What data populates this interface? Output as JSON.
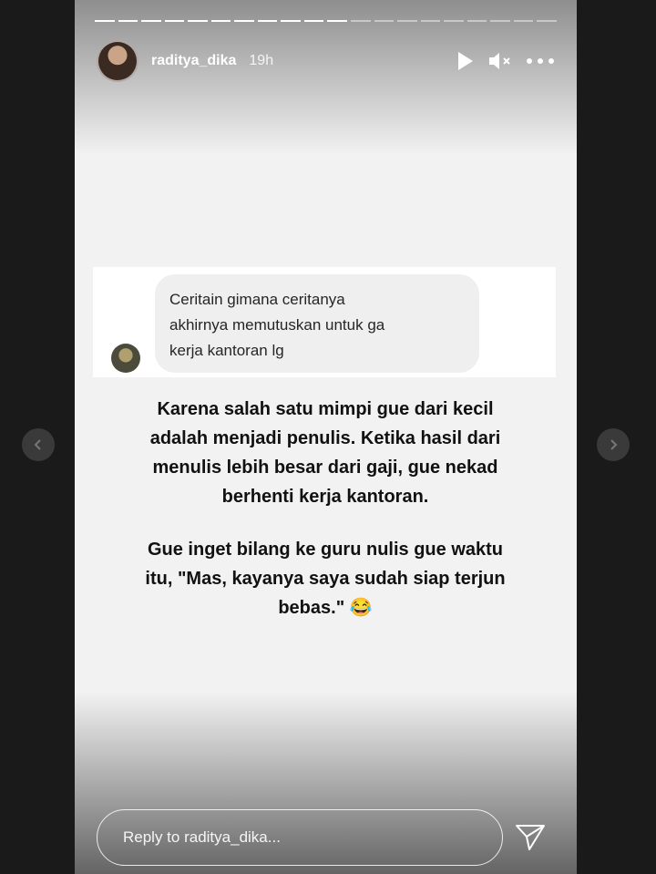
{
  "story": {
    "progress_total": 20,
    "progress_done": 11,
    "user": {
      "username": "raditya_dika",
      "time": "19h"
    },
    "controls": {
      "play_icon": "play-icon",
      "mute_icon": "muted-speaker-icon",
      "more_icon": "more-dots-icon"
    },
    "question": {
      "lines": [
        "Ceritain gimana ceritanya",
        "akhirnya memutuskan untuk ga",
        "kerja kantoran lg"
      ]
    },
    "answer": {
      "paragraph1": [
        "Karena salah satu mimpi gue dari kecil",
        "adalah menjadi penulis. Ketika hasil dari",
        "menulis lebih besar dari gaji, gue nekad",
        "berhenti kerja kantoran."
      ],
      "paragraph2": [
        "Gue inget bilang ke guru nulis gue waktu",
        "itu, \"Mas, kayanya saya sudah siap terjun",
        "bebas.\" 😂"
      ]
    },
    "reply": {
      "placeholder": "Reply to raditya_dika..."
    },
    "send_icon": "paper-plane-icon"
  },
  "navigation": {
    "prev_icon": "chevron-left-icon",
    "next_icon": "chevron-right-icon"
  },
  "colors": {
    "background": "#1a1a1a",
    "card": "#f2f2f2",
    "text": "#111111"
  }
}
